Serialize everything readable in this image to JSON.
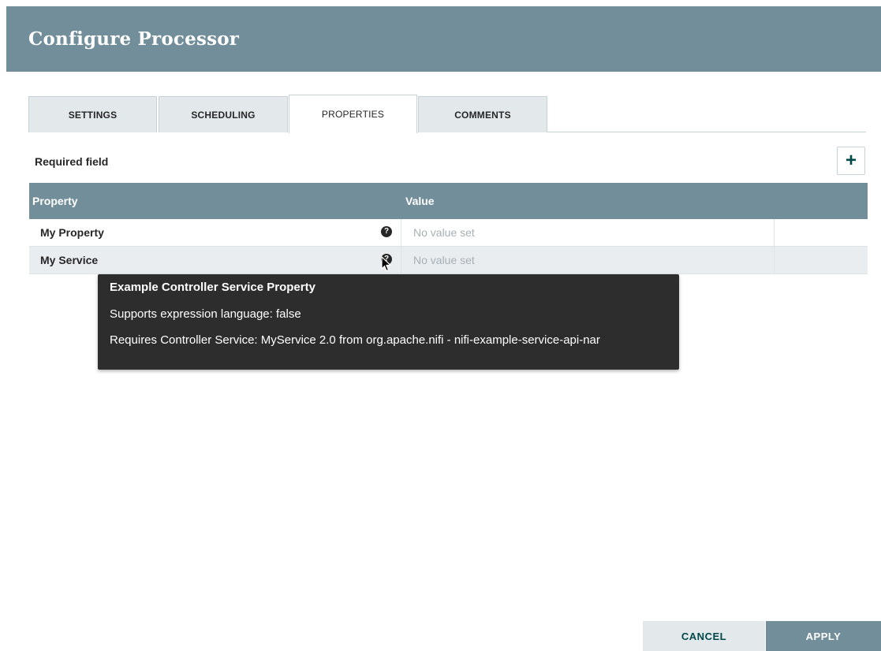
{
  "dialog": {
    "title": "Configure Processor"
  },
  "tabs": [
    {
      "label": "SETTINGS",
      "active": false
    },
    {
      "label": "SCHEDULING",
      "active": false
    },
    {
      "label": "PROPERTIES",
      "active": true
    },
    {
      "label": "COMMENTS",
      "active": false
    }
  ],
  "properties": {
    "required_label": "Required field",
    "add_label": "+",
    "columns": {
      "property": "Property",
      "value": "Value"
    },
    "rows": [
      {
        "name": "My Property",
        "help": "?",
        "value": "No value set"
      },
      {
        "name": "My Service",
        "help": "?",
        "value": "No value set"
      }
    ]
  },
  "tooltip": {
    "title": "Example Controller Service Property",
    "expression_language": "Supports expression language: false",
    "requires": "Requires Controller Service: MyService 2.0 from org.apache.nifi - nifi-example-service-api-nar"
  },
  "footer": {
    "cancel_label": "CANCEL",
    "apply_label": "APPLY"
  },
  "icons": {
    "add": "plus-icon",
    "help": "question-circle-icon",
    "cursor": "mouse-pointer-icon"
  },
  "colors": {
    "header": "#728e9b",
    "tooltip": "#2d2d2d",
    "accent": "#004849"
  }
}
